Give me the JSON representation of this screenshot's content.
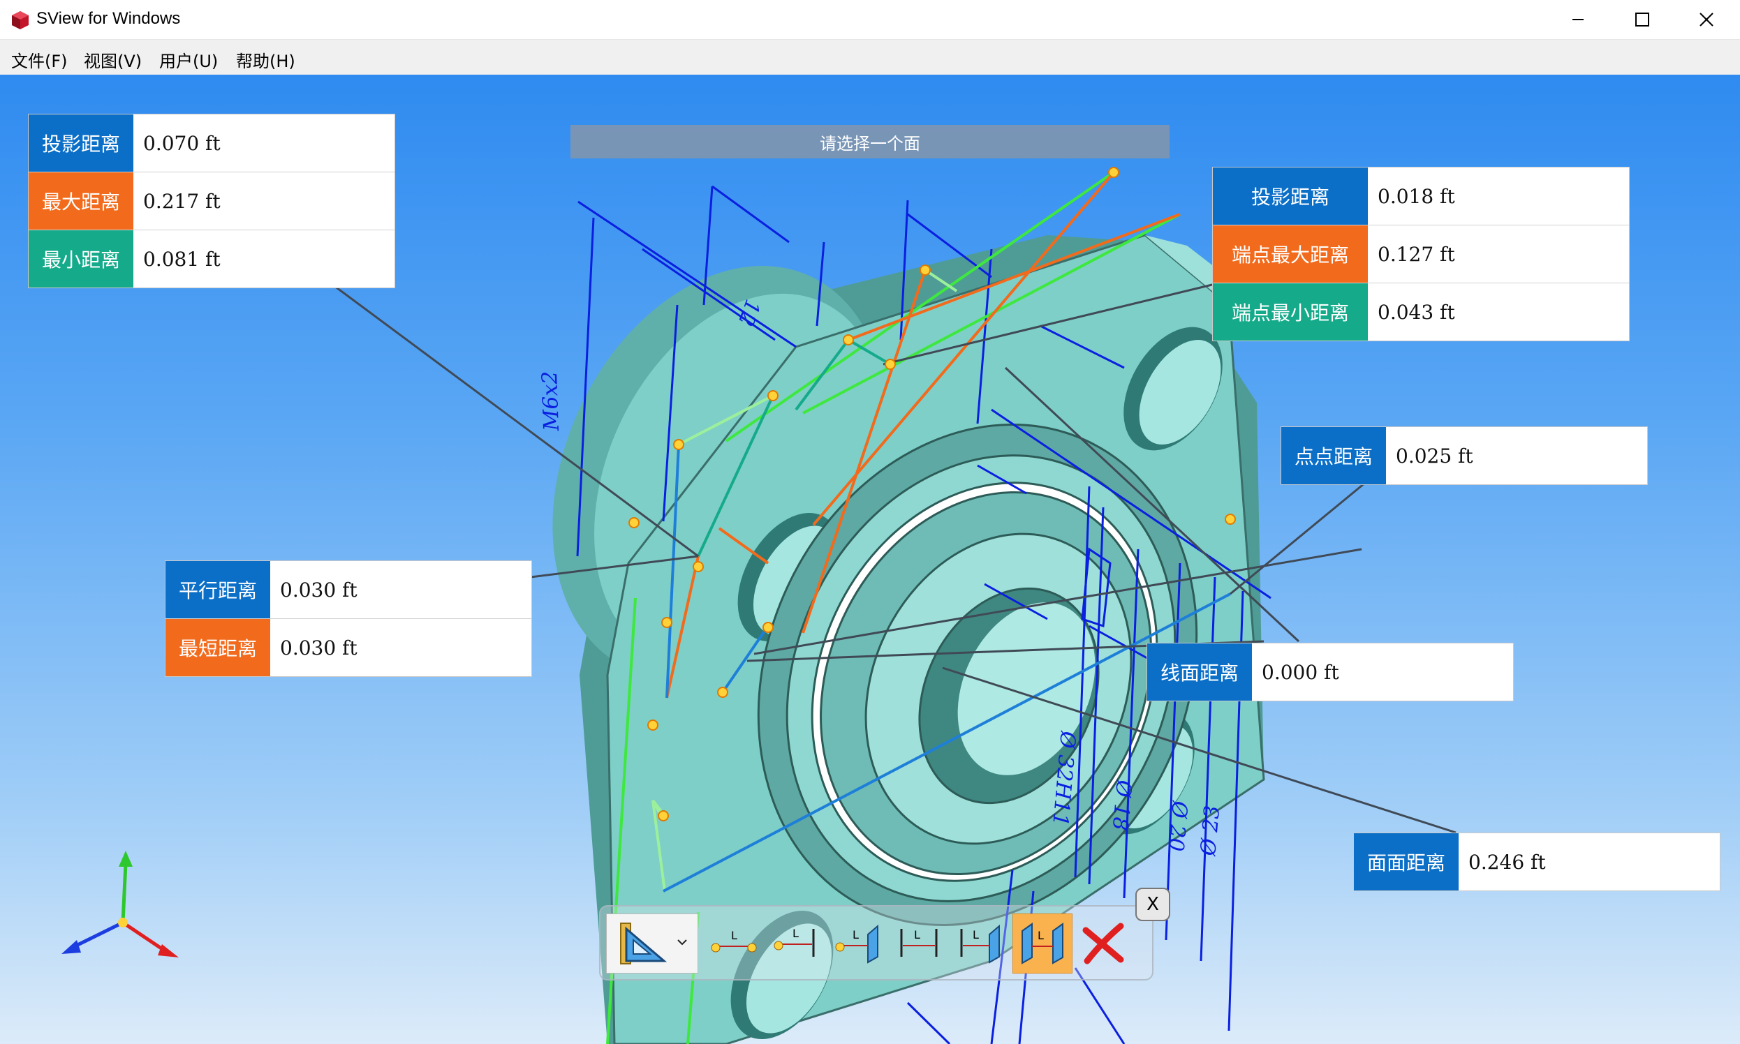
{
  "window": {
    "title": "SView for Windows",
    "controls": [
      "minimize",
      "maximize",
      "close"
    ]
  },
  "menu": [
    {
      "label": "文件(F)"
    },
    {
      "label": "视图(V)"
    },
    {
      "label": "用户(U)"
    },
    {
      "label": "帮助(H)"
    }
  ],
  "prompt": "请选择一个面",
  "measurements": {
    "box1": [
      {
        "label": "投影距离",
        "value": "0.070  ft",
        "color": "#0b6fc8"
      },
      {
        "label": "最大距离",
        "value": "0.217  ft",
        "color": "#f26a1b"
      },
      {
        "label": "最小距离",
        "value": "0.081  ft",
        "color": "#14aa8a"
      }
    ],
    "box2": [
      {
        "label": "投影距离",
        "value": "0.018  ft",
        "color": "#0b6fc8"
      },
      {
        "label": "端点最大距离",
        "value": "0.127  ft",
        "color": "#f26a1b"
      },
      {
        "label": "端点最小距离",
        "value": "0.043  ft",
        "color": "#14aa8a"
      }
    ],
    "box3": [
      {
        "label": "点点距离",
        "value": "0.025  ft",
        "color": "#0b6fc8"
      }
    ],
    "box4": [
      {
        "label": "平行距离",
        "value": "0.030  ft",
        "color": "#0b6fc8"
      },
      {
        "label": "最短距离",
        "value": "0.030  ft",
        "color": "#f26a1b"
      }
    ],
    "box5": [
      {
        "label": "线面距离",
        "value": "0.000  ft",
        "color": "#0b6fc8"
      }
    ],
    "box6": [
      {
        "label": "面面距离",
        "value": "0.246  ft",
        "color": "#0b6fc8"
      }
    ]
  },
  "toolbar": {
    "close_label": "X",
    "tools": [
      "measure-dropdown",
      "point-point",
      "point-line",
      "point-face",
      "line-line",
      "line-face",
      "face-face",
      "delete"
    ],
    "active": "face-face"
  },
  "drawing_labels": {
    "d1": "M6x2",
    "d2": "12",
    "d3": "Ø 32H11",
    "d4": "Ø 23",
    "d5": "Ø 20",
    "d6": "Ø 18"
  },
  "colors": {
    "accent_blue": "#0b6fc8",
    "accent_orange": "#f26a1b",
    "accent_teal": "#14aa8a",
    "part": "#7ecfc8",
    "dimension": "#0a1fe0"
  }
}
